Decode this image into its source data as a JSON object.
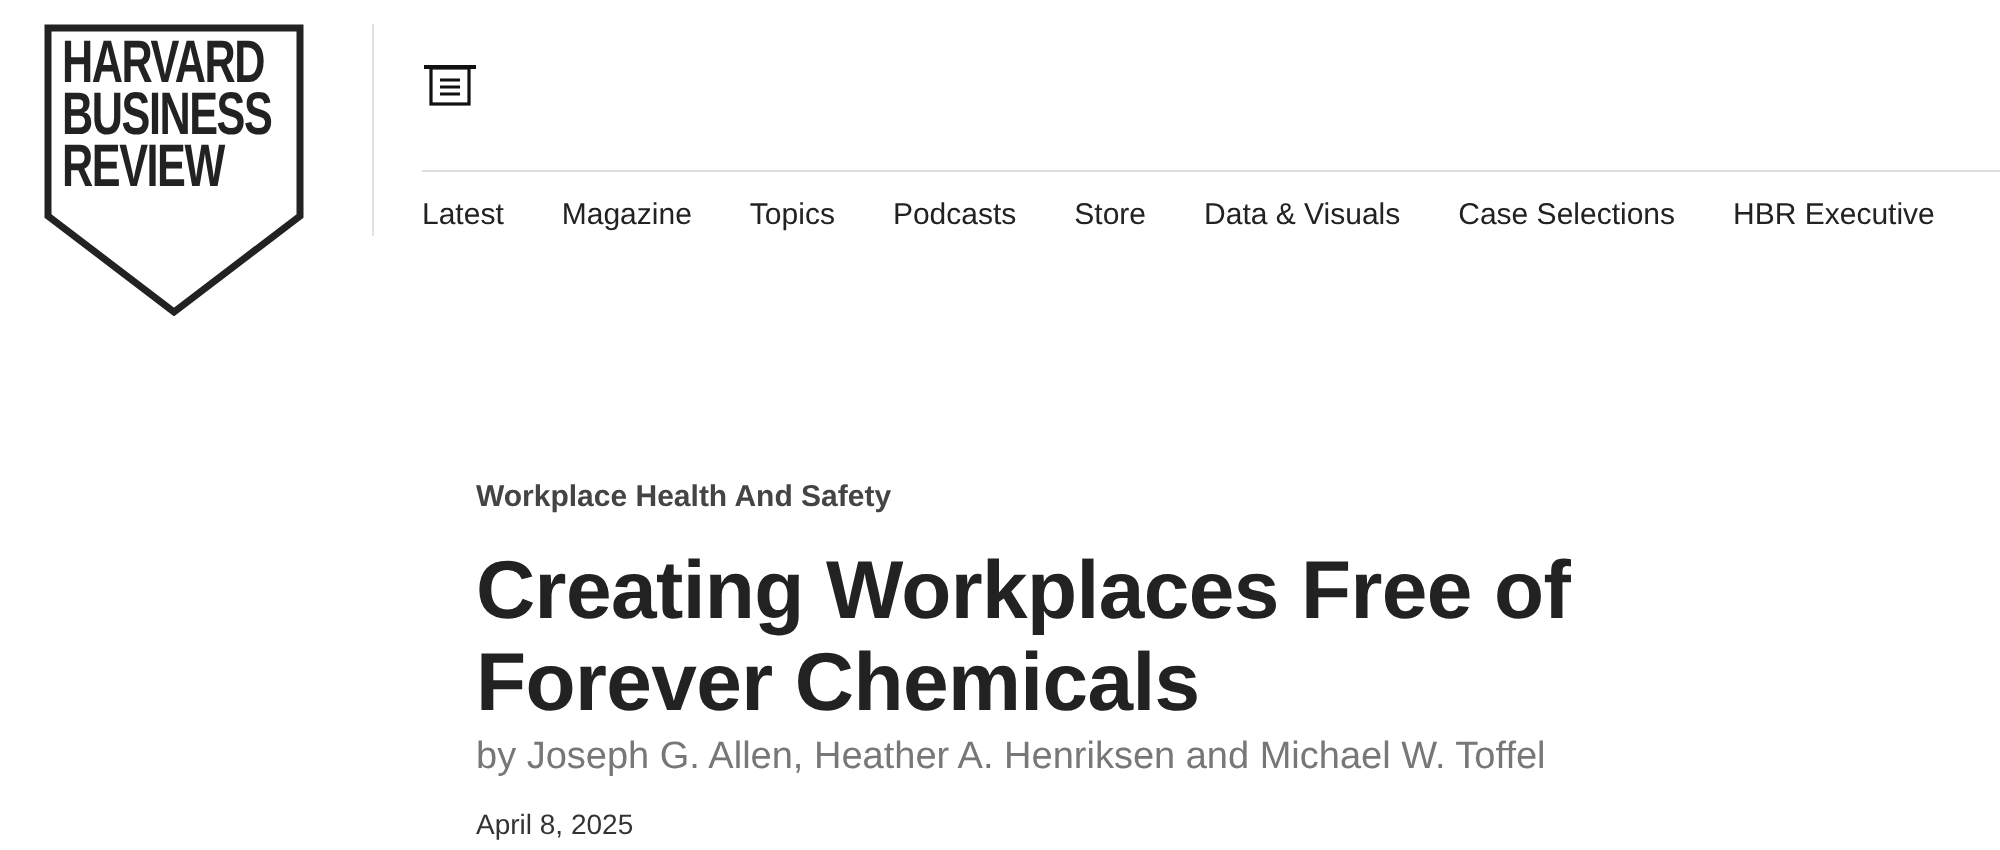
{
  "logo": {
    "lines": [
      "HARVARD",
      "BUSINESS",
      "REVIEW"
    ]
  },
  "nav": {
    "items": [
      {
        "label": "Latest"
      },
      {
        "label": "Magazine"
      },
      {
        "label": "Topics"
      },
      {
        "label": "Podcasts"
      },
      {
        "label": "Store"
      },
      {
        "label": "Data & Visuals"
      },
      {
        "label": "Case Selections"
      },
      {
        "label": "HBR Executive"
      }
    ]
  },
  "article": {
    "topic": "Workplace Health And Safety",
    "title": "Creating Workplaces Free of Forever Chemicals",
    "byline": "by Joseph G. Allen, Heather A. Henriksen and Michael W. Toffel",
    "date": "April 8, 2025"
  }
}
